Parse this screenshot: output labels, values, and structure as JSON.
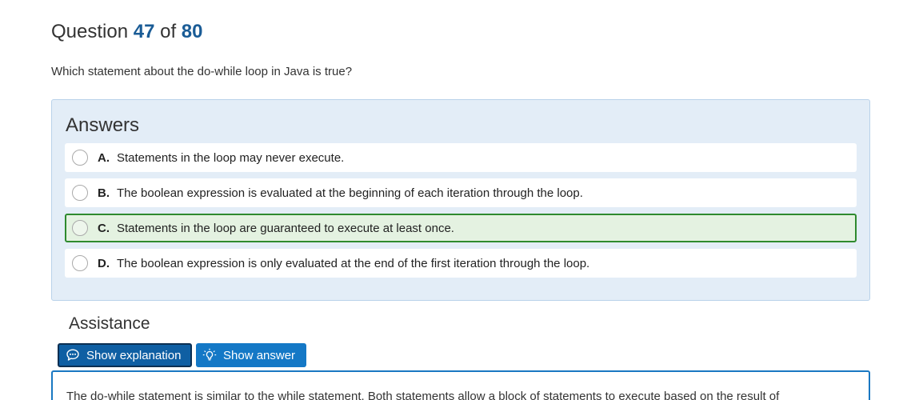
{
  "question": {
    "prefix": "Question",
    "current": "47",
    "separator": "of",
    "total": "80",
    "text": "Which statement about the do-while loop in Java is true?"
  },
  "answers": {
    "title": "Answers",
    "items": [
      {
        "letter": "A.",
        "text": "Statements in the loop may never execute.",
        "correct": false
      },
      {
        "letter": "B.",
        "text": "The boolean expression is evaluated at the beginning of each iteration through the loop.",
        "correct": false
      },
      {
        "letter": "C.",
        "text": "Statements in the loop are guaranteed to execute at least once.",
        "correct": true
      },
      {
        "letter": "D.",
        "text": "The boolean expression is only evaluated at the end of the first iteration through the loop.",
        "correct": false
      }
    ]
  },
  "assistance": {
    "title": "Assistance",
    "show_explanation_label": "Show explanation",
    "show_answer_label": "Show answer",
    "explanation_icon": "speech-bubble-icon",
    "answer_icon": "lightbulb-icon"
  },
  "explanation": {
    "text": "The do-while statement is similar to the while statement. Both statements allow a block of statements to execute based on the result of"
  },
  "colors": {
    "accent": "#1478c6",
    "question_number": "#1a5c96",
    "correct_border": "#2e8a2e",
    "correct_bg": "#e4f2e1",
    "panel_bg": "#e3edf7"
  }
}
